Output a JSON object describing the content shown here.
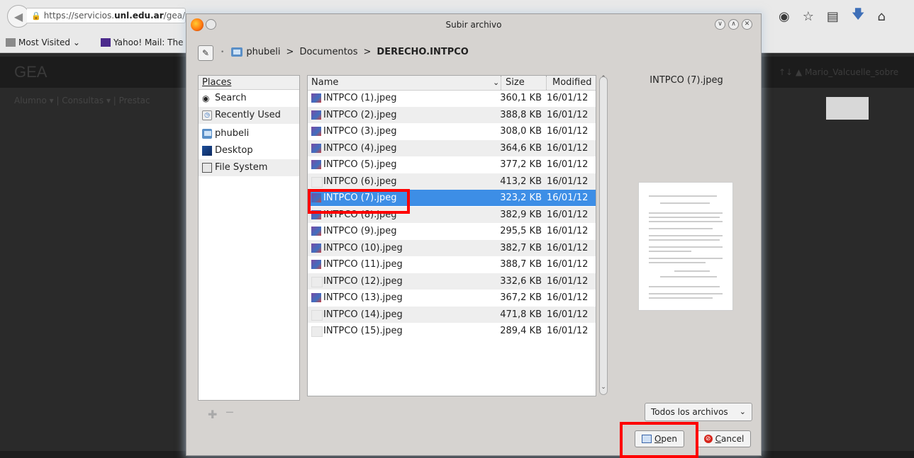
{
  "browser": {
    "url_prefix": "https://servicios.",
    "url_domain": "unl.edu.ar",
    "url_suffix": "/gea/",
    "bookmark_most_visited": "Most Visited ⌄",
    "bookmark_yahoo": "Yahoo! Mail: The b"
  },
  "page": {
    "logo": "GEA",
    "menu_text": "Alumno ▾  |  Consultas ▾  |  Prestac",
    "user_text": "↑↓  ▲ Mario_Valcuelle_sobre"
  },
  "dialog": {
    "title": "Subir archivo",
    "breadcrumb": [
      "phubeli",
      "Documentos",
      "DERECHO.INTPCO"
    ],
    "places_header": "Places",
    "places": [
      {
        "label": "Search",
        "icon": "binoculars-icon"
      },
      {
        "label": "Recently Used",
        "icon": "clock-icon"
      },
      {
        "label": "phubeli",
        "icon": "home-folder-icon"
      },
      {
        "label": "Desktop",
        "icon": "desktop-icon"
      },
      {
        "label": "File System",
        "icon": "drive-icon"
      }
    ],
    "columns": {
      "name": "Name",
      "size": "Size",
      "modified": "Modified"
    },
    "files": [
      {
        "name": "INTPCO (1).jpeg",
        "size": "360,1 KB",
        "modified": "16/01/12"
      },
      {
        "name": "INTPCO (2).jpeg",
        "size": "388,8 KB",
        "modified": "16/01/12"
      },
      {
        "name": "INTPCO (3).jpeg",
        "size": "308,0 KB",
        "modified": "16/01/12"
      },
      {
        "name": "INTPCO (4).jpeg",
        "size": "364,6 KB",
        "modified": "16/01/12"
      },
      {
        "name": "INTPCO (5).jpeg",
        "size": "377,2 KB",
        "modified": "16/01/12"
      },
      {
        "name": "INTPCO (6).jpeg",
        "size": "413,2 KB",
        "modified": "16/01/12"
      },
      {
        "name": "INTPCO (7).jpeg",
        "size": "323,2 KB",
        "modified": "16/01/12"
      },
      {
        "name": "INTPCO (8).jpeg",
        "size": "382,9 KB",
        "modified": "16/01/12"
      },
      {
        "name": "INTPCO (9).jpeg",
        "size": "295,5 KB",
        "modified": "16/01/12"
      },
      {
        "name": "INTPCO (10).jpeg",
        "size": "382,7 KB",
        "modified": "16/01/12"
      },
      {
        "name": "INTPCO (11).jpeg",
        "size": "388,7 KB",
        "modified": "16/01/12"
      },
      {
        "name": "INTPCO (12).jpeg",
        "size": "332,6 KB",
        "modified": "16/01/12"
      },
      {
        "name": "INTPCO (13).jpeg",
        "size": "367,2 KB",
        "modified": "16/01/12"
      },
      {
        "name": "INTPCO (14).jpeg",
        "size": "471,8 KB",
        "modified": "16/01/12"
      },
      {
        "name": "INTPCO (15).jpeg",
        "size": "289,4 KB",
        "modified": "16/01/12"
      }
    ],
    "preview_name": "INTPCO (7).jpeg",
    "filter": "Todos los archivos",
    "open_mnemonic": "O",
    "open_rest": "pen",
    "cancel_mnemonic": "C",
    "cancel_rest": "ancel"
  },
  "colors": {
    "selection": "#3d8ee6",
    "annotation": "#ff0000"
  }
}
